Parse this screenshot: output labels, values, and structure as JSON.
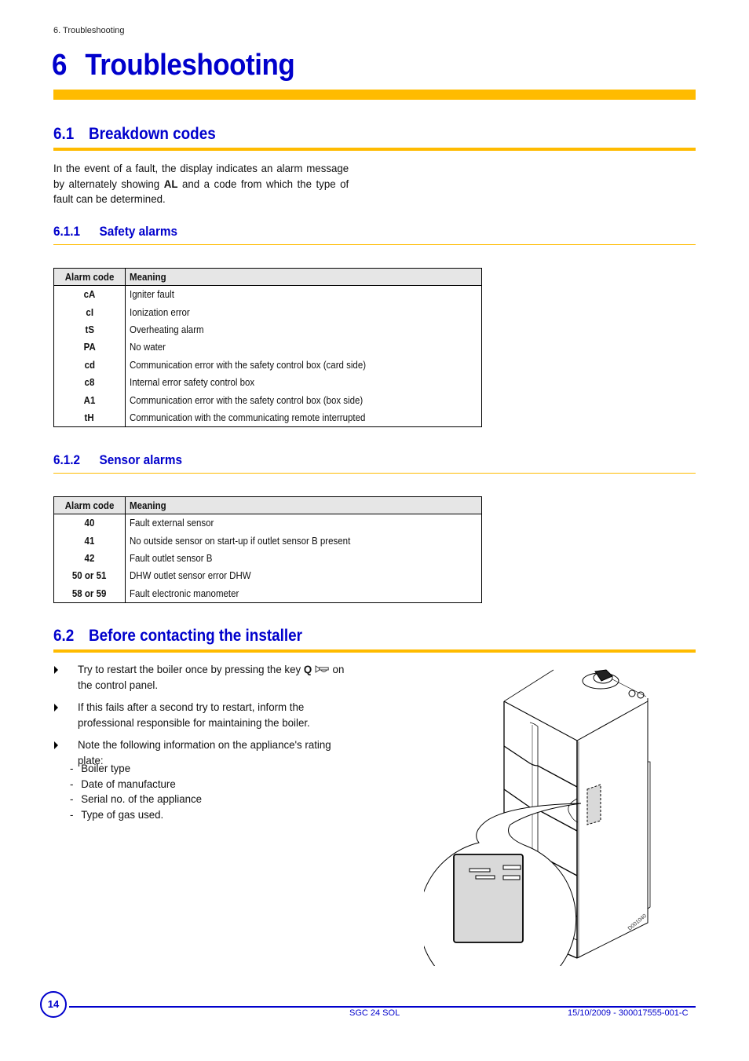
{
  "running_head": "6. Troubleshooting",
  "chapter": {
    "number": "6",
    "title": "Troubleshooting"
  },
  "section_6_1": {
    "number": "6.1",
    "title": "Breakdown codes",
    "intro_before": "In the event of a fault, the display indicates an alarm message by alternately showing ",
    "intro_bold": "AL",
    "intro_after": " and a code from which the type of fault can be determined."
  },
  "section_6_1_1": {
    "number": "6.1.1",
    "title": "Safety alarms",
    "table": {
      "headers": [
        "Alarm code",
        "Meaning"
      ],
      "rows": [
        {
          "code": "cA",
          "meaning": "Igniter fault"
        },
        {
          "code": "cI",
          "meaning": "Ionization error"
        },
        {
          "code": "tS",
          "meaning": "Overheating alarm"
        },
        {
          "code": "PA",
          "meaning": "No water"
        },
        {
          "code": "cd",
          "meaning": "Communication error with the safety control box (card side)"
        },
        {
          "code": "c8",
          "meaning": "Internal error safety control box"
        },
        {
          "code": "A1",
          "meaning": "Communication error with the safety control box (box side)"
        },
        {
          "code": "tH",
          "meaning": "Communication with the communicating remote interrupted"
        }
      ]
    }
  },
  "section_6_1_2": {
    "number": "6.1.2",
    "title": "Sensor alarms",
    "table": {
      "headers": [
        "Alarm code",
        "Meaning"
      ],
      "rows": [
        {
          "code": "40",
          "meaning": "Fault external sensor"
        },
        {
          "code": "41",
          "meaning": "No outside sensor on start-up if outlet sensor B present"
        },
        {
          "code": "42",
          "meaning": "Fault outlet sensor B"
        },
        {
          "code": "50 or 51",
          "meaning": "DHW outlet sensor error DHW"
        },
        {
          "code": "58 or 59",
          "meaning": "Fault electronic manometer"
        }
      ]
    }
  },
  "section_6_2": {
    "number": "6.2",
    "title": "Before contacting the installer",
    "bullets": [
      {
        "before": "Try to restart the boiler once by pressing the key ",
        "key": "Q",
        "icon": "horn-reset-icon",
        "after": " on the control panel."
      },
      {
        "text": "If this fails after a second try to restart, inform the professional responsible for maintaining the boiler."
      },
      {
        "text": "Note the following information on the appliance's rating plate:"
      }
    ],
    "rating_plate_items": [
      "Boiler type",
      "Date of manufacture",
      "Serial no. of the appliance",
      "Type of gas used."
    ]
  },
  "illustration": {
    "label": "D001040",
    "description": "Boiler with rating plate location callout"
  },
  "footer": {
    "page_number": "14",
    "model": "SGC 24 SOL",
    "reference": "15/10/2009 - 300017555-001-C"
  },
  "colors": {
    "heading_blue": "#0000cc",
    "accent_yellow": "#ffbb00",
    "table_header_gray": "#e6e6e6",
    "plate_gray": "#d9d9d9"
  }
}
